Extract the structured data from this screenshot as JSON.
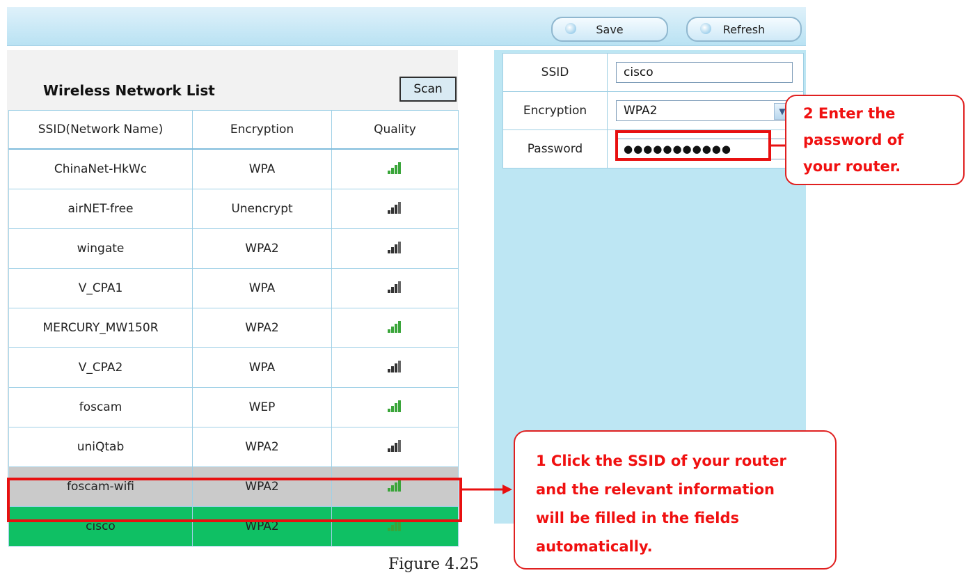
{
  "toolbar": {
    "save_label": "Save",
    "refresh_label": "Refresh"
  },
  "wireless_list": {
    "title": "Wireless Network List",
    "scan_label": "Scan",
    "columns": [
      "SSID(Network Name)",
      "Encryption",
      "Quality"
    ],
    "rows": [
      {
        "ssid": "ChinaNet-HkWc",
        "encryption": "WPA",
        "quality": 0.8,
        "style": "normal"
      },
      {
        "ssid": "airNET-free",
        "encryption": "Unencrypt",
        "quality": 0.6,
        "style": "normal"
      },
      {
        "ssid": "wingate",
        "encryption": "WPA2",
        "quality": 0.6,
        "style": "normal"
      },
      {
        "ssid": "V_CPA1",
        "encryption": "WPA",
        "quality": 0.6,
        "style": "normal"
      },
      {
        "ssid": "MERCURY_MW150R",
        "encryption": "WPA2",
        "quality": 0.8,
        "style": "normal"
      },
      {
        "ssid": "V_CPA2",
        "encryption": "WPA",
        "quality": 0.6,
        "style": "normal"
      },
      {
        "ssid": "foscam",
        "encryption": "WEP",
        "quality": 0.8,
        "style": "normal"
      },
      {
        "ssid": "uniQtab",
        "encryption": "WPA2",
        "quality": 0.6,
        "style": "normal"
      },
      {
        "ssid": "foscam-wifi",
        "encryption": "WPA2",
        "quality": 0.8,
        "style": "gray"
      },
      {
        "ssid": "cisco",
        "encryption": "WPA2",
        "quality": 0.8,
        "style": "green"
      }
    ]
  },
  "form": {
    "ssid_label": "SSID",
    "ssid_value": "cisco",
    "encryption_label": "Encryption",
    "encryption_value": "WPA2",
    "password_label": "Password",
    "password_value": "●●●●●●●●●●●"
  },
  "annotations": {
    "callout_password": [
      "2 Enter the",
      "password of",
      "your router."
    ],
    "callout_ssid": [
      "1 Click the SSID of your router",
      "and the relevant information",
      "will be filled in the fields",
      "automatically."
    ]
  },
  "caption": "Figure 4.25",
  "colors": {
    "accent_red": "#e81010",
    "selected_row": "#0fc064",
    "panel_blue": "#bde6f3",
    "signal_strong": "#3aa53a",
    "signal_weak": "#333333"
  }
}
